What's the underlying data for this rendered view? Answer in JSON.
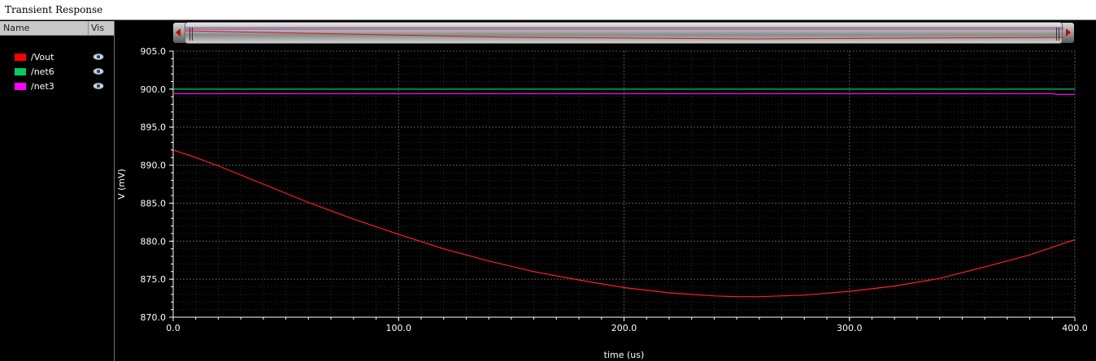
{
  "window": {
    "title": "Transient Response"
  },
  "sidebar": {
    "header": {
      "name": "Name",
      "vis": "Vis"
    },
    "signals": [
      {
        "name": "/Vout",
        "color": "#ff0000",
        "visible_icon": "eye-icon"
      },
      {
        "name": "/net6",
        "color": "#00cc66",
        "visible_icon": "eye-icon"
      },
      {
        "name": "/net3",
        "color": "#ff00ff",
        "visible_icon": "eye-icon"
      }
    ]
  },
  "scrollbar": {
    "left_arrow_icon": "arrow-left-icon",
    "right_arrow_icon": "arrow-right-icon"
  },
  "chart_data": {
    "type": "line",
    "xlabel": "time (us)",
    "ylabel": "V (mV)",
    "xlim": [
      0,
      400
    ],
    "ylim": [
      870,
      905
    ],
    "x_ticks": [
      "0.0",
      "100.0",
      "200.0",
      "300.0",
      "400.0"
    ],
    "y_ticks": [
      "870.0",
      "875.0",
      "880.0",
      "885.0",
      "890.0",
      "895.0",
      "900.0",
      "905.0"
    ],
    "grid": true,
    "background": "#000000",
    "series": [
      {
        "name": "/Vout",
        "color": "#ff2020",
        "x": [
          0,
          10,
          20,
          40,
          60,
          80,
          100,
          120,
          140,
          160,
          180,
          200,
          220,
          240,
          250,
          260,
          280,
          300,
          320,
          340,
          360,
          380,
          400
        ],
        "y": [
          892.0,
          891.0,
          889.9,
          887.5,
          885.1,
          882.9,
          880.9,
          879.0,
          877.4,
          876.0,
          874.9,
          873.9,
          873.2,
          872.8,
          872.7,
          872.7,
          872.9,
          873.4,
          874.1,
          875.1,
          876.6,
          878.2,
          880.2
        ]
      },
      {
        "name": "/net6",
        "color": "#00cc66",
        "x": [
          0,
          400
        ],
        "y": [
          900.0,
          900.0
        ]
      },
      {
        "name": "/net3",
        "color": "#ff00ff",
        "x": [
          0,
          390,
          392,
          400
        ],
        "y": [
          899.4,
          899.4,
          899.3,
          899.3
        ]
      }
    ]
  }
}
